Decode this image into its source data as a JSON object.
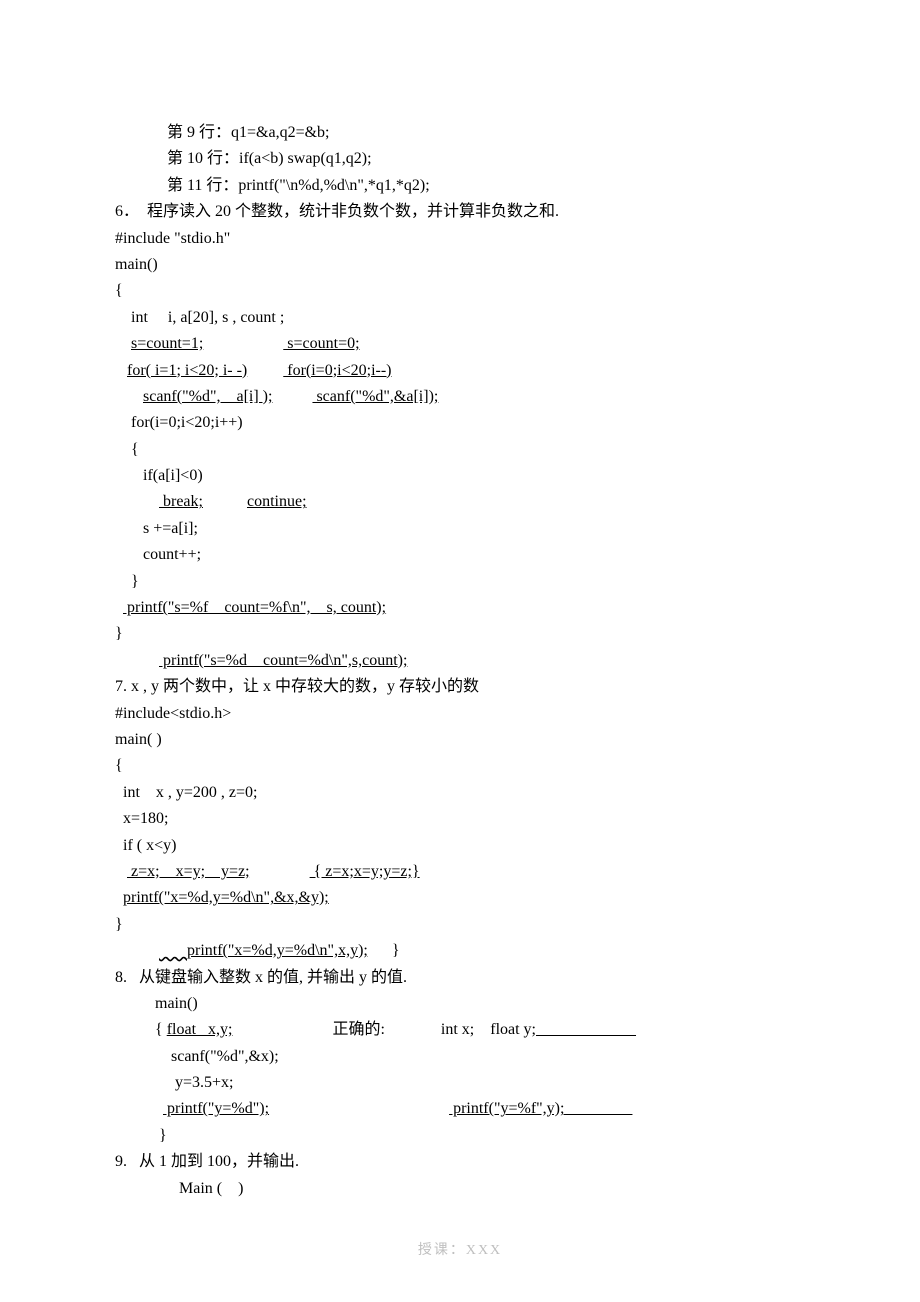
{
  "lines": {
    "l1": "             第 9 行：q1=&a,q2=&b;",
    "l2": "             第 10 行：if(a<b) swap(q1,q2);",
    "l3": "             第 11 行：printf(\"\\n%d,%d\\n\",*q1,*q2);",
    "l4": "",
    "l5": "6．  程序读入 20 个整数，统计非负数个数，并计算非负数之和.",
    "l6": "#include \"stdio.h\"",
    "l7": "main()",
    "l8": "{",
    "l9": "    int     i, a[20], s , count ;",
    "l10a": "    ",
    "l10u1": "s=count=1;",
    "l10b": "                    ",
    "l10u2": " s=count=0;",
    "l11a": "   ",
    "l11u1": "for( i=1; i<20; i- -)",
    "l11b": "         ",
    "l11u2": " for(i=0;i<20;i--)",
    "l12a": "       ",
    "l12u1": "scanf(\"%d\",    a[i] );",
    "l12b": "          ",
    "l12u2": " scanf(\"%d\",&a[i]);",
    "l13": "    for(i=0;i<20;i++)",
    "l14": "    {",
    "l15": "       if(a[i]<0)",
    "l16a": "           ",
    "l16u1": " break;",
    "l16b": "           ",
    "l16u2": "continue;",
    "l17": "       s +=a[i];",
    "l18": "       count++;",
    "l19": "    }",
    "l20a": "  ",
    "l20u1": " printf(\"s=%f    count=%f\\n\",    s, count);",
    "l21": "}",
    "l22a": "           ",
    "l22u1": " printf(\"s=%d    count=%d\\n\",s,count);",
    "l23": "7. x , y 两个数中，让 x 中存较大的数，y 存较小的数",
    "l24": "#include<stdio.h>",
    "l25": "main( )",
    "l26": "{",
    "l27": "  int    x , y=200 , z=0;",
    "l28": "",
    "l29": "  x=180;",
    "l30": "  if ( x<y)",
    "l31a": "   ",
    "l31u1": " z=x;    x=y;    y=z;",
    "l31b": "               ",
    "l31u2": " { z=x;x=y;y=z;}",
    "l32a": "  ",
    "l32u1": "printf(\"x=%d,y=%d\\n\",&x,&y);",
    "l33": "}",
    "l34a": "           ",
    "l34w": "       ",
    "l34u1": "printf(\"x=%d,y=%d\\n\",x,y);",
    "l34b": "      }",
    "l35": "",
    "l36": "8.   从键盘输入整数 x 的值, 并输出 y 的值.",
    "l37": "          main()",
    "l38a": "          { ",
    "l38u1": "float   x,y;",
    "l38b": "                         正确的:              int x;    float y;",
    "l38u2": "                         ",
    "l39": "              scanf(\"%d\",&x);",
    "l40": "               y=3.5+x;",
    "l41a": "            ",
    "l41u1": " printf(\"y=%d\");",
    "l41b": "                                             ",
    "l41u2": " printf(\"y=%f\",y);                 ",
    "l42": "           }",
    "l43": "9.   从 1 加到 100，并输出.",
    "l44": "                Main (    )"
  },
  "footer": "授课：XXX"
}
